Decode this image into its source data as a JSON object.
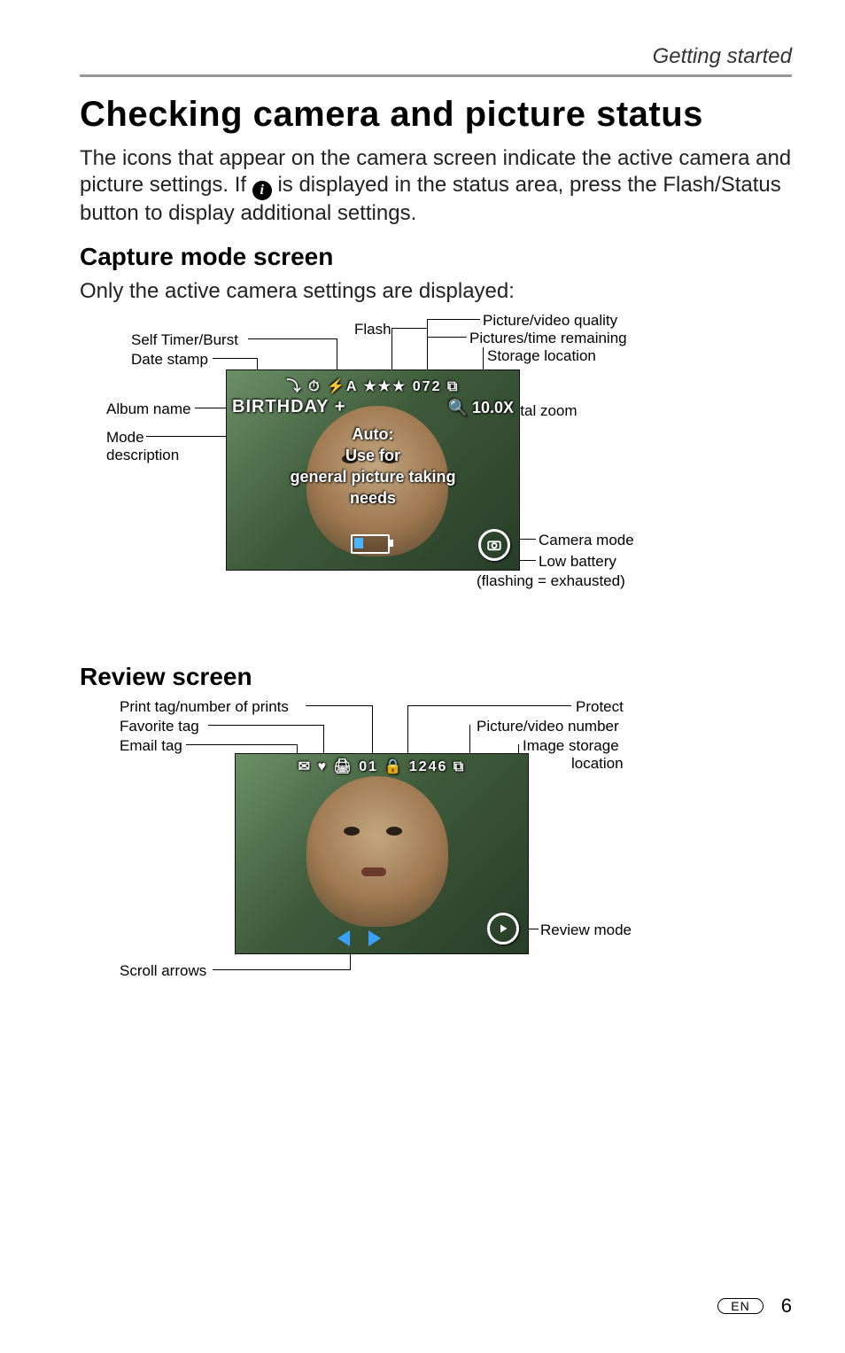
{
  "running_head": "Getting started",
  "h1": "Checking camera and picture status",
  "intro_a": "The icons that appear on the camera screen indicate the active camera and picture settings. If ",
  "intro_b": " is displayed in the status area, press the Flash/Status button to display additional settings.",
  "info_icon_glyph": "i",
  "capture": {
    "heading": "Capture mode screen",
    "subtext": "Only the active camera settings are displayed:",
    "callouts": {
      "flash": "Flash",
      "quality": "Picture/video quality",
      "remaining": "Pictures/time remaining",
      "storage": "Storage location",
      "self_timer": "Self Timer/Burst",
      "date_stamp": "Date stamp",
      "album_name": "Album name",
      "mode_desc": "Mode description",
      "digital_zoom": "Digital zoom",
      "camera_mode": "Camera mode",
      "low_batt": "Low battery",
      "low_batt_sub": "(flashing = exhausted)"
    },
    "osd": {
      "top_icons": "⤵ ⏱ ⚡A ★★★ 072 ⧉",
      "album": "BIRTHDAY",
      "album_plus": "+",
      "zoom_text": "10.0X",
      "mode_line1": "Auto:",
      "mode_line2": "Use for",
      "mode_line3": "general picture taking",
      "mode_line4": "needs"
    }
  },
  "review": {
    "heading": "Review screen",
    "callouts": {
      "print_tag": "Print tag/number of prints",
      "favorite_tag": "Favorite tag",
      "email_tag": "Email tag",
      "protect": "Protect",
      "pic_number": "Picture/video number",
      "storage": "Image storage location",
      "review_mode": "Review mode",
      "scroll_arrows": "Scroll arrows"
    },
    "osd": {
      "top_line": "✉ ♥   🖨 01 🔒 1246 ⧉"
    }
  },
  "footer": {
    "lang": "EN",
    "page": "6"
  }
}
